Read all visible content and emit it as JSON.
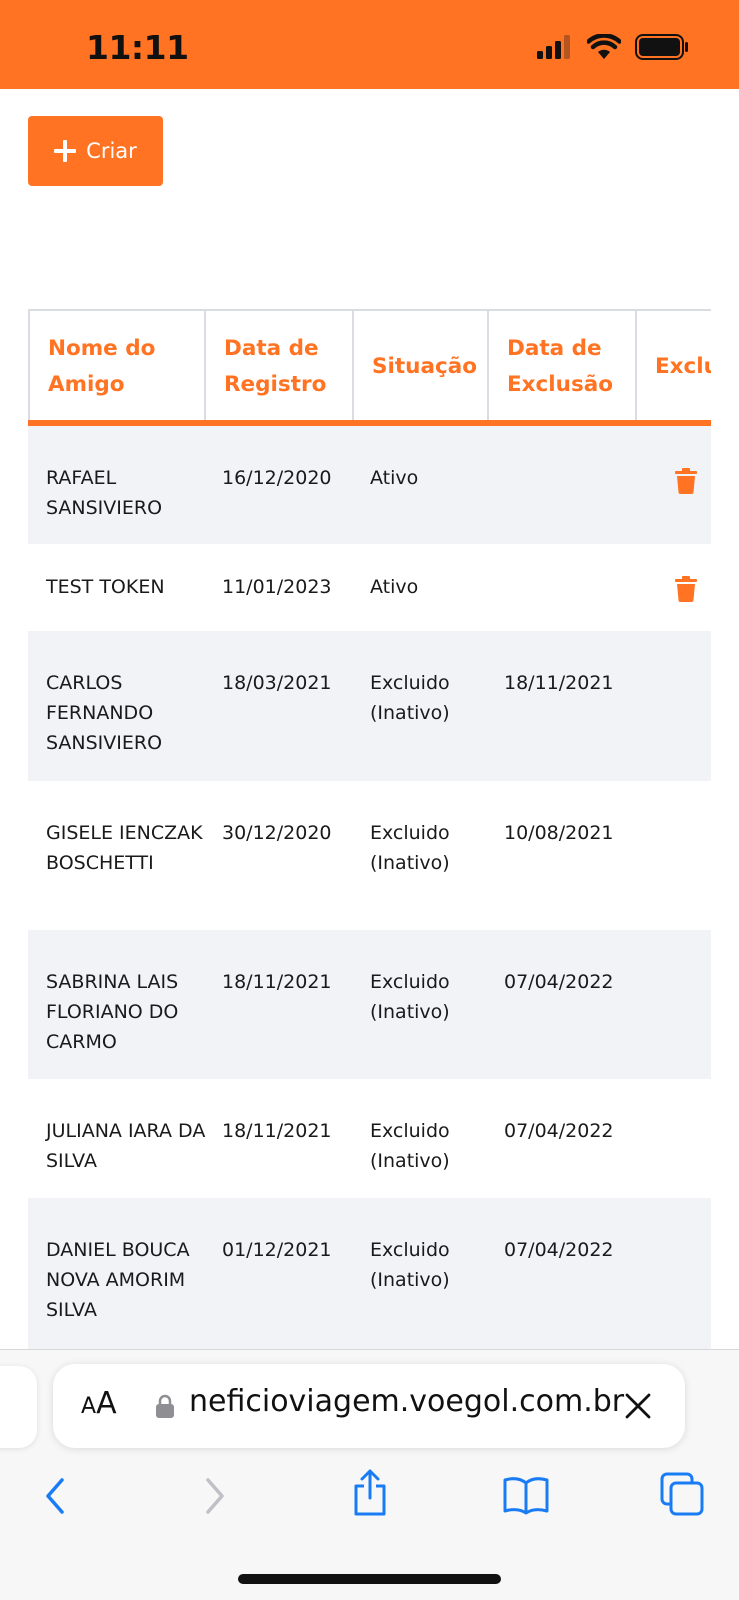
{
  "status_bar": {
    "time": "11:11"
  },
  "toolbar": {
    "create_label": "Criar"
  },
  "table": {
    "headers": [
      "Nome do Amigo",
      "Data de Registro",
      "Situação",
      "Data de Exclusão",
      "Exclu"
    ],
    "rows": [
      {
        "name": "RAFAEL SANSIVIERO",
        "registro": "16/12/2020",
        "situacao": "Ativo",
        "exclusao": "",
        "deletable": true
      },
      {
        "name": "TEST TOKEN",
        "registro": "11/01/2023",
        "situacao": "Ativo",
        "exclusao": "",
        "deletable": true
      },
      {
        "name": "CARLOS FERNANDO SANSIVIERO",
        "registro": "18/03/2021",
        "situacao": "Excluido (Inativo)",
        "exclusao": "18/11/2021",
        "deletable": false
      },
      {
        "name": "GISELE IENCZAK BOSCHETTI",
        "registro": "30/12/2020",
        "situacao": "Excluido (Inativo)",
        "exclusao": "10/08/2021",
        "deletable": false
      },
      {
        "name": "SABRINA LAIS FLORIANO DO CARMO",
        "registro": "18/11/2021",
        "situacao": "Excluido (Inativo)",
        "exclusao": "07/04/2022",
        "deletable": false
      },
      {
        "name": "JULIANA IARA DA SILVA",
        "registro": "18/11/2021",
        "situacao": "Excluido (Inativo)",
        "exclusao": "07/04/2022",
        "deletable": false
      },
      {
        "name": "DANIEL BOUCA NOVA AMORIM SILVA",
        "registro": "01/12/2021",
        "situacao": "Excluido (Inativo)",
        "exclusao": "07/04/2022",
        "deletable": false
      }
    ]
  },
  "browser": {
    "text_size_label": "AA",
    "url": "neficioviagem.voegol.com.br"
  },
  "colors": {
    "accent": "#FF7322",
    "row_alt": "#f2f3f7",
    "ios_blue": "#1a7cf5"
  },
  "icons": [
    "signal-icon",
    "wifi-icon",
    "battery-icon",
    "plus-icon",
    "trash-icon",
    "lock-icon",
    "close-icon",
    "back-icon",
    "forward-icon",
    "share-icon",
    "bookmarks-icon",
    "tabs-icon"
  ]
}
